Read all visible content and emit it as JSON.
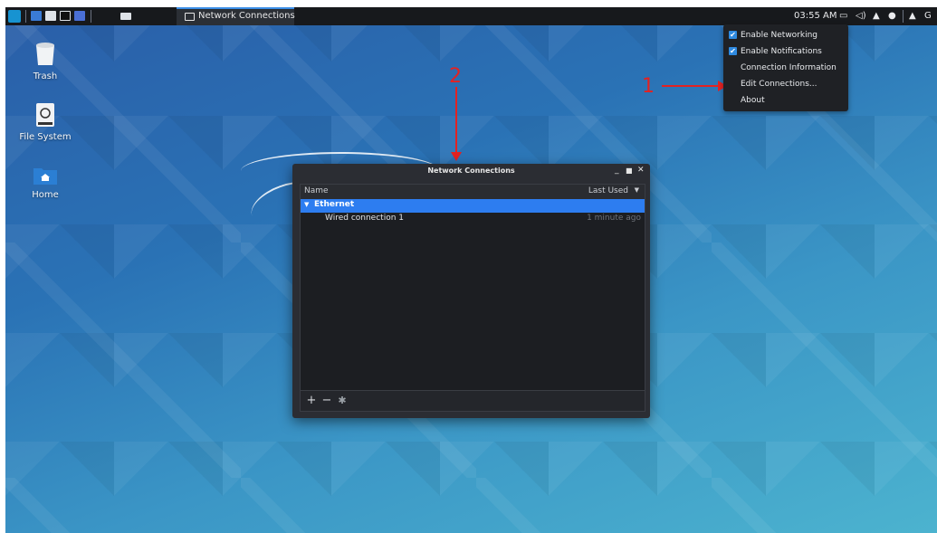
{
  "taskbar": {
    "active_task": "Network Connections",
    "clock": "03:55 AM",
    "tray_trailing": "G"
  },
  "desktop": {
    "icons": [
      {
        "label": "Trash",
        "icon": "trash-icon"
      },
      {
        "label": "File System",
        "icon": "drive-icon"
      },
      {
        "label": "Home",
        "icon": "home-folder-icon"
      }
    ]
  },
  "annotations": {
    "step1": "1",
    "step2": "2"
  },
  "network_menu": {
    "items": [
      {
        "label": "Enable Networking",
        "checked": true
      },
      {
        "label": "Enable Notifications",
        "checked": true
      },
      {
        "label": "Connection Information",
        "checked": false
      },
      {
        "label": "Edit Connections...",
        "checked": false
      },
      {
        "label": "About",
        "checked": false
      }
    ]
  },
  "window": {
    "title": "Network Connections",
    "columns": {
      "name": "Name",
      "last_used": "Last Used"
    },
    "groups": [
      {
        "label": "Ethernet",
        "rows": [
          {
            "name": "Wired connection 1",
            "last_used": "1 minute ago"
          }
        ]
      }
    ],
    "toolbar": {
      "add": "+",
      "remove": "−"
    }
  },
  "colors": {
    "accent": "#2d7df0",
    "annotation": "#e32222",
    "taskbar": "#17191c",
    "window_bg": "#2b2d33"
  }
}
